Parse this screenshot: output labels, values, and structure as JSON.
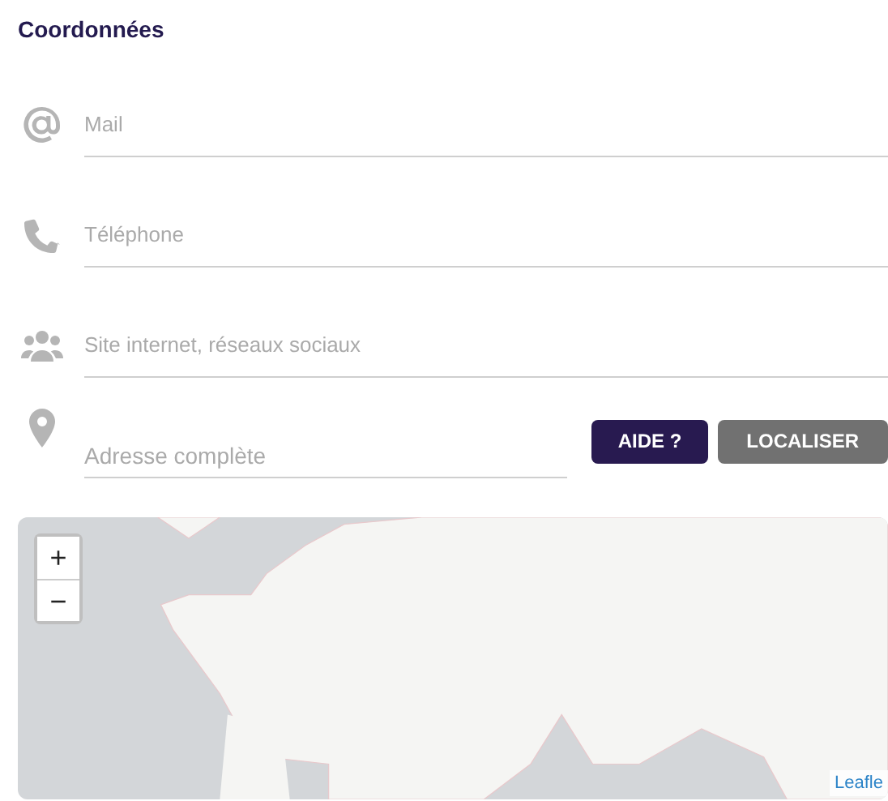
{
  "section_title": "Coordonnées",
  "fields": [
    {
      "kind": "email",
      "placeholder": "Mail"
    },
    {
      "kind": "phone",
      "placeholder": "Téléphone"
    },
    {
      "kind": "people",
      "placeholder": "Site internet, réseaux sociaux"
    }
  ],
  "address": {
    "placeholder": "Adresse complète",
    "buttons": [
      {
        "label": "AIDE ?",
        "kind": "primary"
      },
      {
        "label": "LOCALISER",
        "kind": "secondary"
      }
    ]
  },
  "map": {
    "zoom_in": "+",
    "zoom_out": "−",
    "attribution": "Leafle"
  }
}
